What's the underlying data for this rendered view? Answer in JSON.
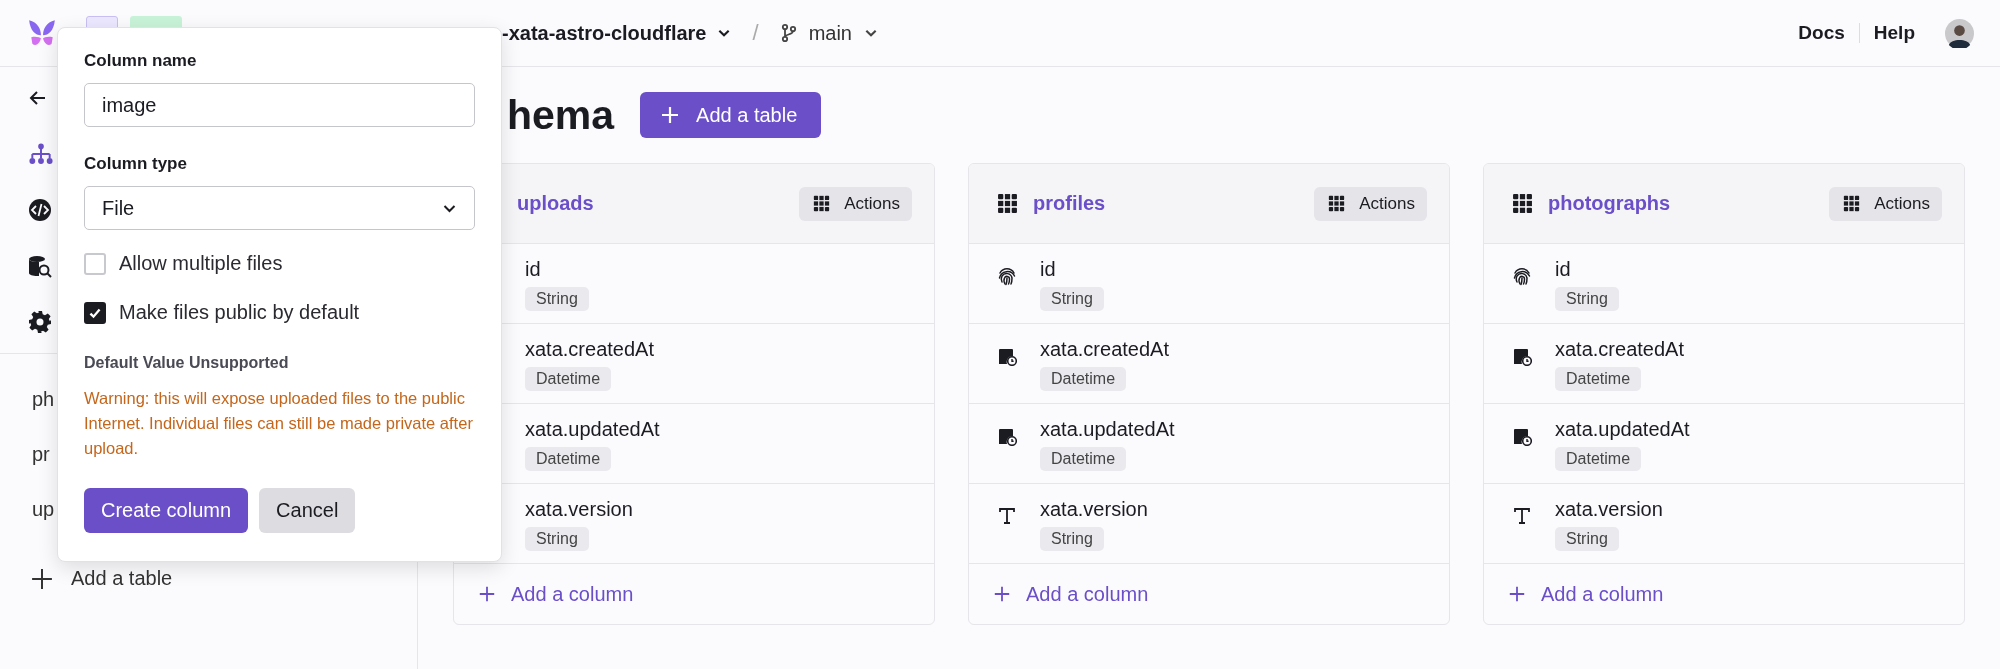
{
  "top_bar": {
    "project_fragment": "-xata-astro-cloudflare",
    "separator": "/",
    "branch": "main",
    "links": [
      "Docs",
      "Help"
    ]
  },
  "sidebar": {
    "nav": [
      {
        "kind": "back",
        "selected": false
      },
      {
        "kind": "schema",
        "selected": true
      },
      {
        "kind": "code",
        "selected": false
      },
      {
        "kind": "search",
        "selected": false
      },
      {
        "kind": "settings",
        "selected": false
      }
    ],
    "items": [
      "ph",
      "pr",
      "up"
    ],
    "add_label": "Add a table"
  },
  "main": {
    "heading": "hema",
    "add_button": "Add a table",
    "tables": [
      {
        "name": "uploads",
        "action": "Actions",
        "add_column": "Add a column",
        "fields": [
          {
            "name": "id",
            "type": "String"
          },
          {
            "name": "xata.createdAt",
            "type": "Datetime"
          },
          {
            "name": "xata.updatedAt",
            "type": "Datetime"
          },
          {
            "name": "xata.version",
            "type": "String"
          }
        ]
      },
      {
        "name": "profiles",
        "kind": "table",
        "action": "Actions",
        "add_column": "Add a column",
        "fields": [
          {
            "name": "id",
            "type": "String",
            "kind": "id"
          },
          {
            "name": "xata.createdAt",
            "type": "Datetime",
            "kind": "datetime"
          },
          {
            "name": "xata.updatedAt",
            "type": "Datetime",
            "kind": "datetime"
          },
          {
            "name": "xata.version",
            "type": "String",
            "kind": "text"
          }
        ]
      },
      {
        "name": "photographs",
        "kind": "table",
        "action": "Actions",
        "add_column": "Add a column",
        "fields": [
          {
            "name": "id",
            "type": "String",
            "kind": "id"
          },
          {
            "name": "xata.createdAt",
            "type": "Datetime",
            "kind": "datetime"
          },
          {
            "name": "xata.updatedAt",
            "type": "Datetime",
            "kind": "datetime"
          },
          {
            "name": "xata.version",
            "type": "String",
            "kind": "text"
          }
        ]
      }
    ]
  },
  "popover": {
    "name_label": "Column name",
    "name_value": "image",
    "type_label": "Column type",
    "type_value": "File",
    "options": [
      {
        "label": "Allow multiple files",
        "checked": false
      },
      {
        "label": "Make files public by default",
        "checked": true
      }
    ],
    "default_title": "Default Value Unsupported",
    "warning": "Warning: this will expose uploaded files to the public Internet. Individual files can still be made private after upload.",
    "buttons": [
      {
        "label": "Create column",
        "kind": "primary"
      },
      {
        "label": "Cancel",
        "kind": "secondary"
      }
    ]
  }
}
